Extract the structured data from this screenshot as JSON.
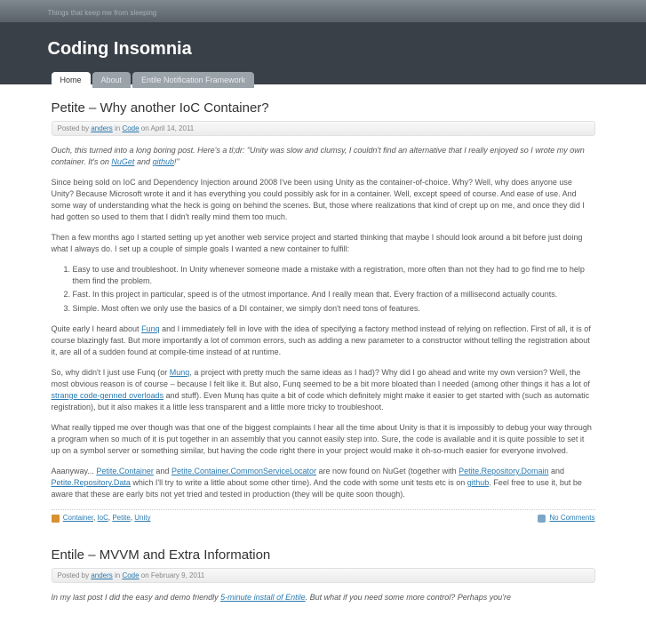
{
  "site": {
    "tagline": "Things that keep me from sleeping",
    "title": "Coding Insomnia"
  },
  "nav": {
    "items": [
      {
        "label": "Home",
        "active": true
      },
      {
        "label": "About",
        "active": false
      },
      {
        "label": "Entile Notification Framework",
        "active": false
      }
    ]
  },
  "posts": [
    {
      "title": "Petite – Why another IoC Container?",
      "meta": {
        "prefix": "Posted by ",
        "author": "anders",
        "in": " in ",
        "category": "Code",
        "on": " on ",
        "date": "April 14, 2011"
      },
      "intro_parts": {
        "p1": "Ouch, this turned into a long boring post. Here's a tl;dr: \"Unity was slow and clumsy, I couldn't find an alternative that I really enjoyed so I wrote my own container. It's on ",
        "link1": "NuGet",
        "mid": " and ",
        "link2": "github",
        "tail": "!\""
      },
      "p2": "Since being sold on IoC and Dependency Injection around 2008 I've been using Unity as the container-of-choice. Why? Well, why does anyone use Unity? Because Microsoft wrote it and it has everything you could possibly ask for in a container. Well, except speed of course. And ease of use. And some way of understanding what the heck is going on behind the scenes. But, those where realizations that kind of crept up on me, and once they did I had gotten so used to them that I didn't really mind them too much.",
      "p3": "Then a few months ago I started setting up yet another web service project and started thinking that maybe I should look around a bit before just doing what I always do. I set up a couple of simple goals I wanted a new container to fulfill:",
      "goals": [
        "Easy to use and troubleshoot. In Unity whenever someone made a mistake with a registration, more often than not they had to go find me to help them find the problem.",
        "Fast. In this project in particular, speed is of the utmost importance. And I really mean that. Every fraction of a millisecond actually counts.",
        "Simple. Most often we only use the basics of a DI container, we simply don't need tons of features."
      ],
      "p4_parts": {
        "pre": "Quite early I heard about ",
        "link": "Funq",
        "post": " and I immediately fell in love with the idea of specifying a factory method instead of relying on reflection. First of all, it is of course blazingly fast. But more importantly a lot of common errors, such as adding a new parameter to a constructor without telling the registration about it, are all of a sudden found at compile-time instead of at runtime."
      },
      "p5_parts": {
        "pre": "So, why didn't I just use Funq (or ",
        "link1": "Munq",
        "mid1": ", a project with pretty much the same ideas as I had)? Why did I go ahead and write my own version? Well, the most obvious reason is of course – because I felt like it. But also, Funq seemed to be a bit more bloated than I needed (among other things it has a lot of ",
        "link2": "strange code-genned overloads",
        "post": " and stuff). Even Munq has quite a bit of code which definitely might make it easier to get started with (such as automatic registration), but it also makes it a little less transparent and a little more tricky to troubleshoot."
      },
      "p6": "What really tipped me over though was that one of the biggest complaints I hear all the time about Unity is that it is impossibly to debug your way through a program when so much of it is put together in an assembly that you cannot easily step into. Sure, the code is available and it is quite possible to set it up on a symbol server or something similar, but having the code right there in your project would make it oh-so-much easier for everyone involved.",
      "p7_parts": {
        "pre": "Aaanyway... ",
        "l1": "Petite.Container",
        "m1": " and ",
        "l2": "Petite.Container.CommonServiceLocator",
        "m2": " are now found on NuGet (together with ",
        "l3": "Petite.Repository.Domain",
        "m3": " and ",
        "l4": "Petite.Repository.Data",
        "m4": " which I'll try to write a little about some other time). And the code with some unit tests etc is on ",
        "l5": "github",
        "post": ". Feel free to use it, but be aware that these are early bits not yet tried and tested in production (they will be quite soon though)."
      },
      "tags": [
        "Container",
        "IoC",
        "Petite",
        "Unity"
      ],
      "comments": "No Comments"
    },
    {
      "title": "Entile – MVVM and Extra Information",
      "meta": {
        "prefix": "Posted by ",
        "author": "anders",
        "in": " in ",
        "category": "Code",
        "on": " on ",
        "date": "February 9, 2011"
      },
      "intro_parts": {
        "pre": "In my last post I did the easy and demo friendly ",
        "link": "5-minute install of Entile",
        "post": ". But what if you need some more control? Perhaps you're"
      }
    }
  ]
}
